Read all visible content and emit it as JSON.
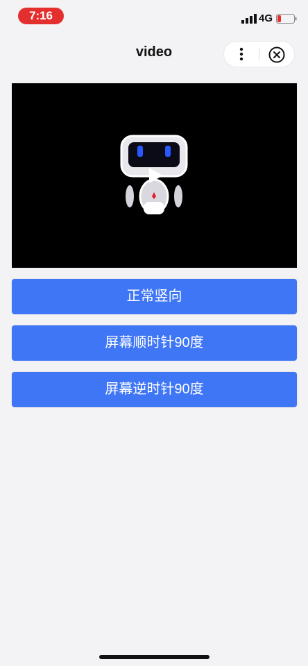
{
  "status_bar": {
    "time": "7:16",
    "network": "4G",
    "icons": [
      "signal-icon",
      "battery-icon"
    ]
  },
  "nav": {
    "title": "video",
    "capsule_icons": [
      "menu-icon",
      "close-icon"
    ]
  },
  "video": {
    "icon": "play-icon"
  },
  "buttons": {
    "normal_vertical": "正常竖向",
    "rotate_clockwise_90": "屏幕顺时针90度",
    "rotate_counterclockwise_90": "屏幕逆时针90度"
  },
  "colors": {
    "primary_button": "#3f76f6",
    "time_pill": "#e3302f",
    "background": "#f3f2f5"
  }
}
